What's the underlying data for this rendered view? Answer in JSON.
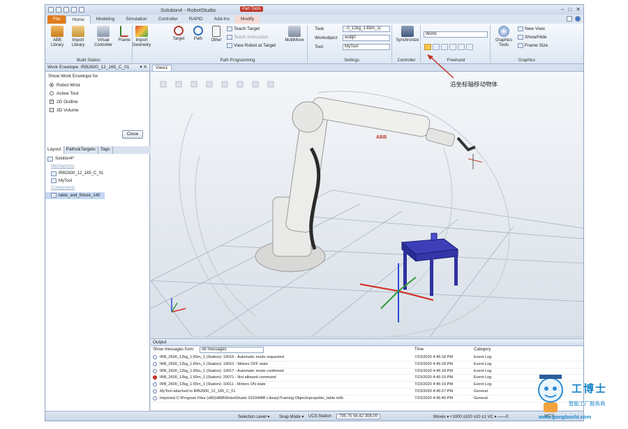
{
  "window": {
    "title": "Solution4 - RobotStudio",
    "context_tag": "Part Tools"
  },
  "tabs": [
    "File",
    "Home",
    "Modeling",
    "Simulation",
    "Controller",
    "RAPID",
    "Add-Ins",
    "Modify"
  ],
  "ribbon": {
    "build_station": {
      "label": "Build Station",
      "abb_library": "ABB Library",
      "import_library": "Import Library",
      "virtual_controller": "Virtual Controller",
      "import_geometry": "Import Geometry",
      "frame": "Frame"
    },
    "path_programming": {
      "label": "Path Programming",
      "target": "Target",
      "path": "Path",
      "other": "Other",
      "teach_target": "Teach Target",
      "teach_instruction": "Teach Instruction",
      "view_robot_at_target": "View Robot at Target",
      "multimove": "MultiMove"
    },
    "settings": {
      "label": "Settings",
      "task_label": "Task",
      "task_value": "..0_12kg_1.65m_1(",
      "workobject_label": "Workobject",
      "workobject_value": "wobj0",
      "tool_label": "Tool",
      "tool_value": "MyTool"
    },
    "controller": {
      "label": "Controller",
      "synchronize": "Synchronize"
    },
    "freehand": {
      "label": "Freehand",
      "frame_value": "World"
    },
    "graphics": {
      "label": "Graphics",
      "graphics_tools": "Graphics Tools",
      "new_view": "New View",
      "show_hide": "Show/Hide",
      "frame_size": "Frame Size"
    }
  },
  "work_envelope": {
    "title": "Work Envelope: IRB2600_12_165_C_01",
    "show_for": "Show Work Envelope for",
    "robot_wrist": "Robot Wrist",
    "active_tool": "Active Tool",
    "outline_2d": "2D Outline",
    "volume_3d": "3D Volume",
    "close": "Close"
  },
  "layout_tabs": [
    "Layout",
    "Paths&Targets",
    "Tags"
  ],
  "tree": {
    "solution": "Solution4*",
    "mechanisms": "Mechanisms",
    "robot": "IRB2600_12_165_C_01",
    "tool": "MyTool",
    "components": "Components",
    "component": "table_and_fixture_140"
  },
  "viewport": {
    "tab": "View1"
  },
  "annotation": "沿坐标轴移动物体",
  "output": {
    "title": "Output",
    "show_from_label": "Show messages from:",
    "filter_value": "All messages",
    "col_time": "Time",
    "col_category": "Category",
    "rows": [
      {
        "msg": "IRB_2600_12kg_1.65m_1 (Station): 10016 - Automatic mode requested",
        "time": "7/23/2020 4:45:18 PM",
        "cat": "Event Log",
        "err": false
      },
      {
        "msg": "IRB_2600_12kg_1.65m_1 (Station): 10010 - Motors OFF state",
        "time": "7/23/2020 4:45:18 PM",
        "cat": "Event Log",
        "err": false
      },
      {
        "msg": "IRB_2600_12kg_1.65m_1 (Station): 10017 - Automatic mode confirmed",
        "time": "7/23/2020 4:45:18 PM",
        "cat": "Event Log",
        "err": false
      },
      {
        "msg": "IRB_2600_12kg_1.65m_1 (Station): 20071 - Not allowed command",
        "time": "7/23/2020 4:45:19 PM",
        "cat": "Event Log",
        "err": true
      },
      {
        "msg": "IRB_2600_12kg_1.65m_1 (Station): 10011 - Motors ON state",
        "time": "7/23/2020 4:45:19 PM",
        "cat": "Event Log",
        "err": false
      },
      {
        "msg": "MyTool attached to IRB2600_12_165_C_01",
        "time": "7/23/2020 4:45:27 PM",
        "cat": "General",
        "err": false
      },
      {
        "msg": "Imported C:\\Program Files (x86)\\ABB\\RobotStudio 2019\\ABB Library\\Training Objects\\propeller_table.rslib",
        "time": "7/23/2020 4:45:40 PM",
        "cat": "General",
        "err": false
      }
    ]
  },
  "status": {
    "selection_level": "Selection Level ▾",
    "snap_mode": "Snap Mode ▾",
    "ucs": "UCS:Station",
    "coords": "795.75  56.42  308.00",
    "moves": "Moves ▾  +1000  ±100  ±10  ±1  VC ▾  ——0",
    "wcs": "WCS:"
  },
  "watermark": {
    "name": "工博士",
    "sub": "智能工厂服务商",
    "url": "www.gongboshi.com"
  }
}
